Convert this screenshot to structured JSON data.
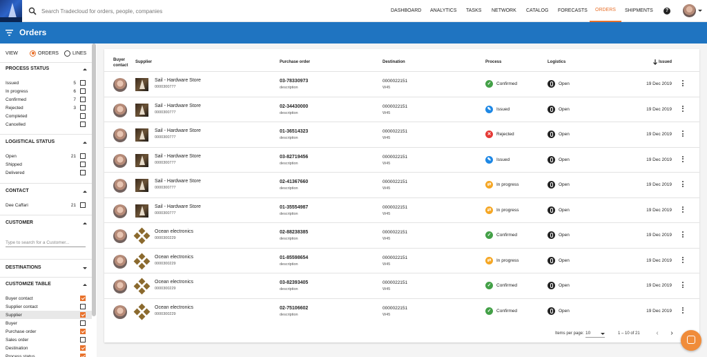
{
  "header": {
    "search_placeholder": "Search Tradecloud for orders, people, companies",
    "nav": [
      "DASHBOARD",
      "ANALYTICS",
      "TASKS",
      "NETWORK",
      "CATALOG",
      "FORECASTS",
      "ORDERS",
      "SHIPMENTS"
    ],
    "active_nav": "ORDERS",
    "help_glyph": "?"
  },
  "titlebar": {
    "title": "Orders"
  },
  "sidebar": {
    "view_label": "VIEW",
    "view_options": [
      "ORDERS",
      "LINES"
    ],
    "view_selected": "ORDERS",
    "process_status": {
      "title": "PROCESS STATUS",
      "items": [
        {
          "label": "Issued",
          "count": "5"
        },
        {
          "label": "In progress",
          "count": "6"
        },
        {
          "label": "Confirmed",
          "count": "7"
        },
        {
          "label": "Rejected",
          "count": "3"
        },
        {
          "label": "Completed",
          "count": ""
        },
        {
          "label": "Cancelled",
          "count": ""
        }
      ]
    },
    "logistical_status": {
      "title": "LOGISTICAL STATUS",
      "items": [
        {
          "label": "Open",
          "count": "21"
        },
        {
          "label": "Shipped",
          "count": ""
        },
        {
          "label": "Delivered",
          "count": ""
        }
      ]
    },
    "contact": {
      "title": "CONTACT",
      "items": [
        {
          "label": "Dee Caffari",
          "count": "21"
        }
      ]
    },
    "customer": {
      "title": "CUSTOMER",
      "placeholder": "Type to search for a Customer..."
    },
    "destinations": {
      "title": "DESTINATIONS"
    },
    "customize_table": {
      "title": "CUSTOMIZE TABLE",
      "items": [
        {
          "label": "Buyer contact",
          "checked": true
        },
        {
          "label": "Supplier contact",
          "checked": false
        },
        {
          "label": "Supplier",
          "checked": true
        },
        {
          "label": "Buyer",
          "checked": false
        },
        {
          "label": "Purchase order",
          "checked": true
        },
        {
          "label": "Sales order",
          "checked": false
        },
        {
          "label": "Destination",
          "checked": true
        },
        {
          "label": "Process status",
          "checked": true
        }
      ]
    }
  },
  "table": {
    "headers": {
      "buyer_contact": "Buyer contact",
      "supplier": "Supplier",
      "purchase_order": "Purchase order",
      "destination": "Destination",
      "process": "Process",
      "logistics": "Logistics",
      "issued": "Issued"
    },
    "status_colors": {
      "Confirmed": "#43a047",
      "Issued": "#1e88e5",
      "Rejected": "#e53935",
      "In progress": "#f5a623"
    },
    "rows": [
      {
        "supplier": "Sail - Hardware Store",
        "supplier_no": "0000300777",
        "logo": "sail",
        "po": "03-78330973",
        "po_desc": "description",
        "dest": "0000022151",
        "dest_sub": "W45",
        "process": "Confirmed",
        "logistics": "Open",
        "issued": "19 Dec 2019"
      },
      {
        "supplier": "Sail - Hardware Store",
        "supplier_no": "0000300777",
        "logo": "sail",
        "po": "02-34430000",
        "po_desc": "description",
        "dest": "0000022151",
        "dest_sub": "W45",
        "process": "Issued",
        "logistics": "Open",
        "issued": "19 Dec 2019"
      },
      {
        "supplier": "Sail - Hardware Store",
        "supplier_no": "0000300777",
        "logo": "sail",
        "po": "01-36514323",
        "po_desc": "description",
        "dest": "0000022151",
        "dest_sub": "W45",
        "process": "Rejected",
        "logistics": "Open",
        "issued": "19 Dec 2019"
      },
      {
        "supplier": "Sail - Hardware Store",
        "supplier_no": "0000300777",
        "logo": "sail",
        "po": "03-82719456",
        "po_desc": "description",
        "dest": "0000022151",
        "dest_sub": "W45",
        "process": "Issued",
        "logistics": "Open",
        "issued": "19 Dec 2019"
      },
      {
        "supplier": "Sail - Hardware Store",
        "supplier_no": "0000300777",
        "logo": "sail",
        "po": "02-41367660",
        "po_desc": "description",
        "dest": "0000022151",
        "dest_sub": "W45",
        "process": "In progress",
        "logistics": "Open",
        "issued": "19 Dec 2019"
      },
      {
        "supplier": "Sail - Hardware Store",
        "supplier_no": "0000300777",
        "logo": "sail",
        "po": "01-35554987",
        "po_desc": "description",
        "dest": "0000022151",
        "dest_sub": "W45",
        "process": "In progress",
        "logistics": "Open",
        "issued": "19 Dec 2019"
      },
      {
        "supplier": "Ocean electronics",
        "supplier_no": "0000300229",
        "logo": "ocean",
        "po": "02-88238385",
        "po_desc": "description",
        "dest": "0000022151",
        "dest_sub": "W45",
        "process": "Confirmed",
        "logistics": "Open",
        "issued": "19 Dec 2019"
      },
      {
        "supplier": "Ocean electronics",
        "supplier_no": "0000300229",
        "logo": "ocean",
        "po": "01-85598654",
        "po_desc": "description",
        "dest": "0000022151",
        "dest_sub": "W45",
        "process": "In progress",
        "logistics": "Open",
        "issued": "19 Dec 2019"
      },
      {
        "supplier": "Ocean electronics",
        "supplier_no": "0000300229",
        "logo": "ocean",
        "po": "03-82393405",
        "po_desc": "description",
        "dest": "0000022151",
        "dest_sub": "W45",
        "process": "Confirmed",
        "logistics": "Open",
        "issued": "19 Dec 2019"
      },
      {
        "supplier": "Ocean electronics",
        "supplier_no": "0000300229",
        "logo": "ocean",
        "po": "02-75106602",
        "po_desc": "description",
        "dest": "0000022151",
        "dest_sub": "W45",
        "process": "Confirmed",
        "logistics": "Open",
        "issued": "19 Dec 2019"
      }
    ]
  },
  "pager": {
    "items_per_page_label": "Items per page:",
    "items_per_page": "10",
    "range": "1 – 10 of 21",
    "prev_glyph": "‹",
    "next_glyph": "›"
  }
}
